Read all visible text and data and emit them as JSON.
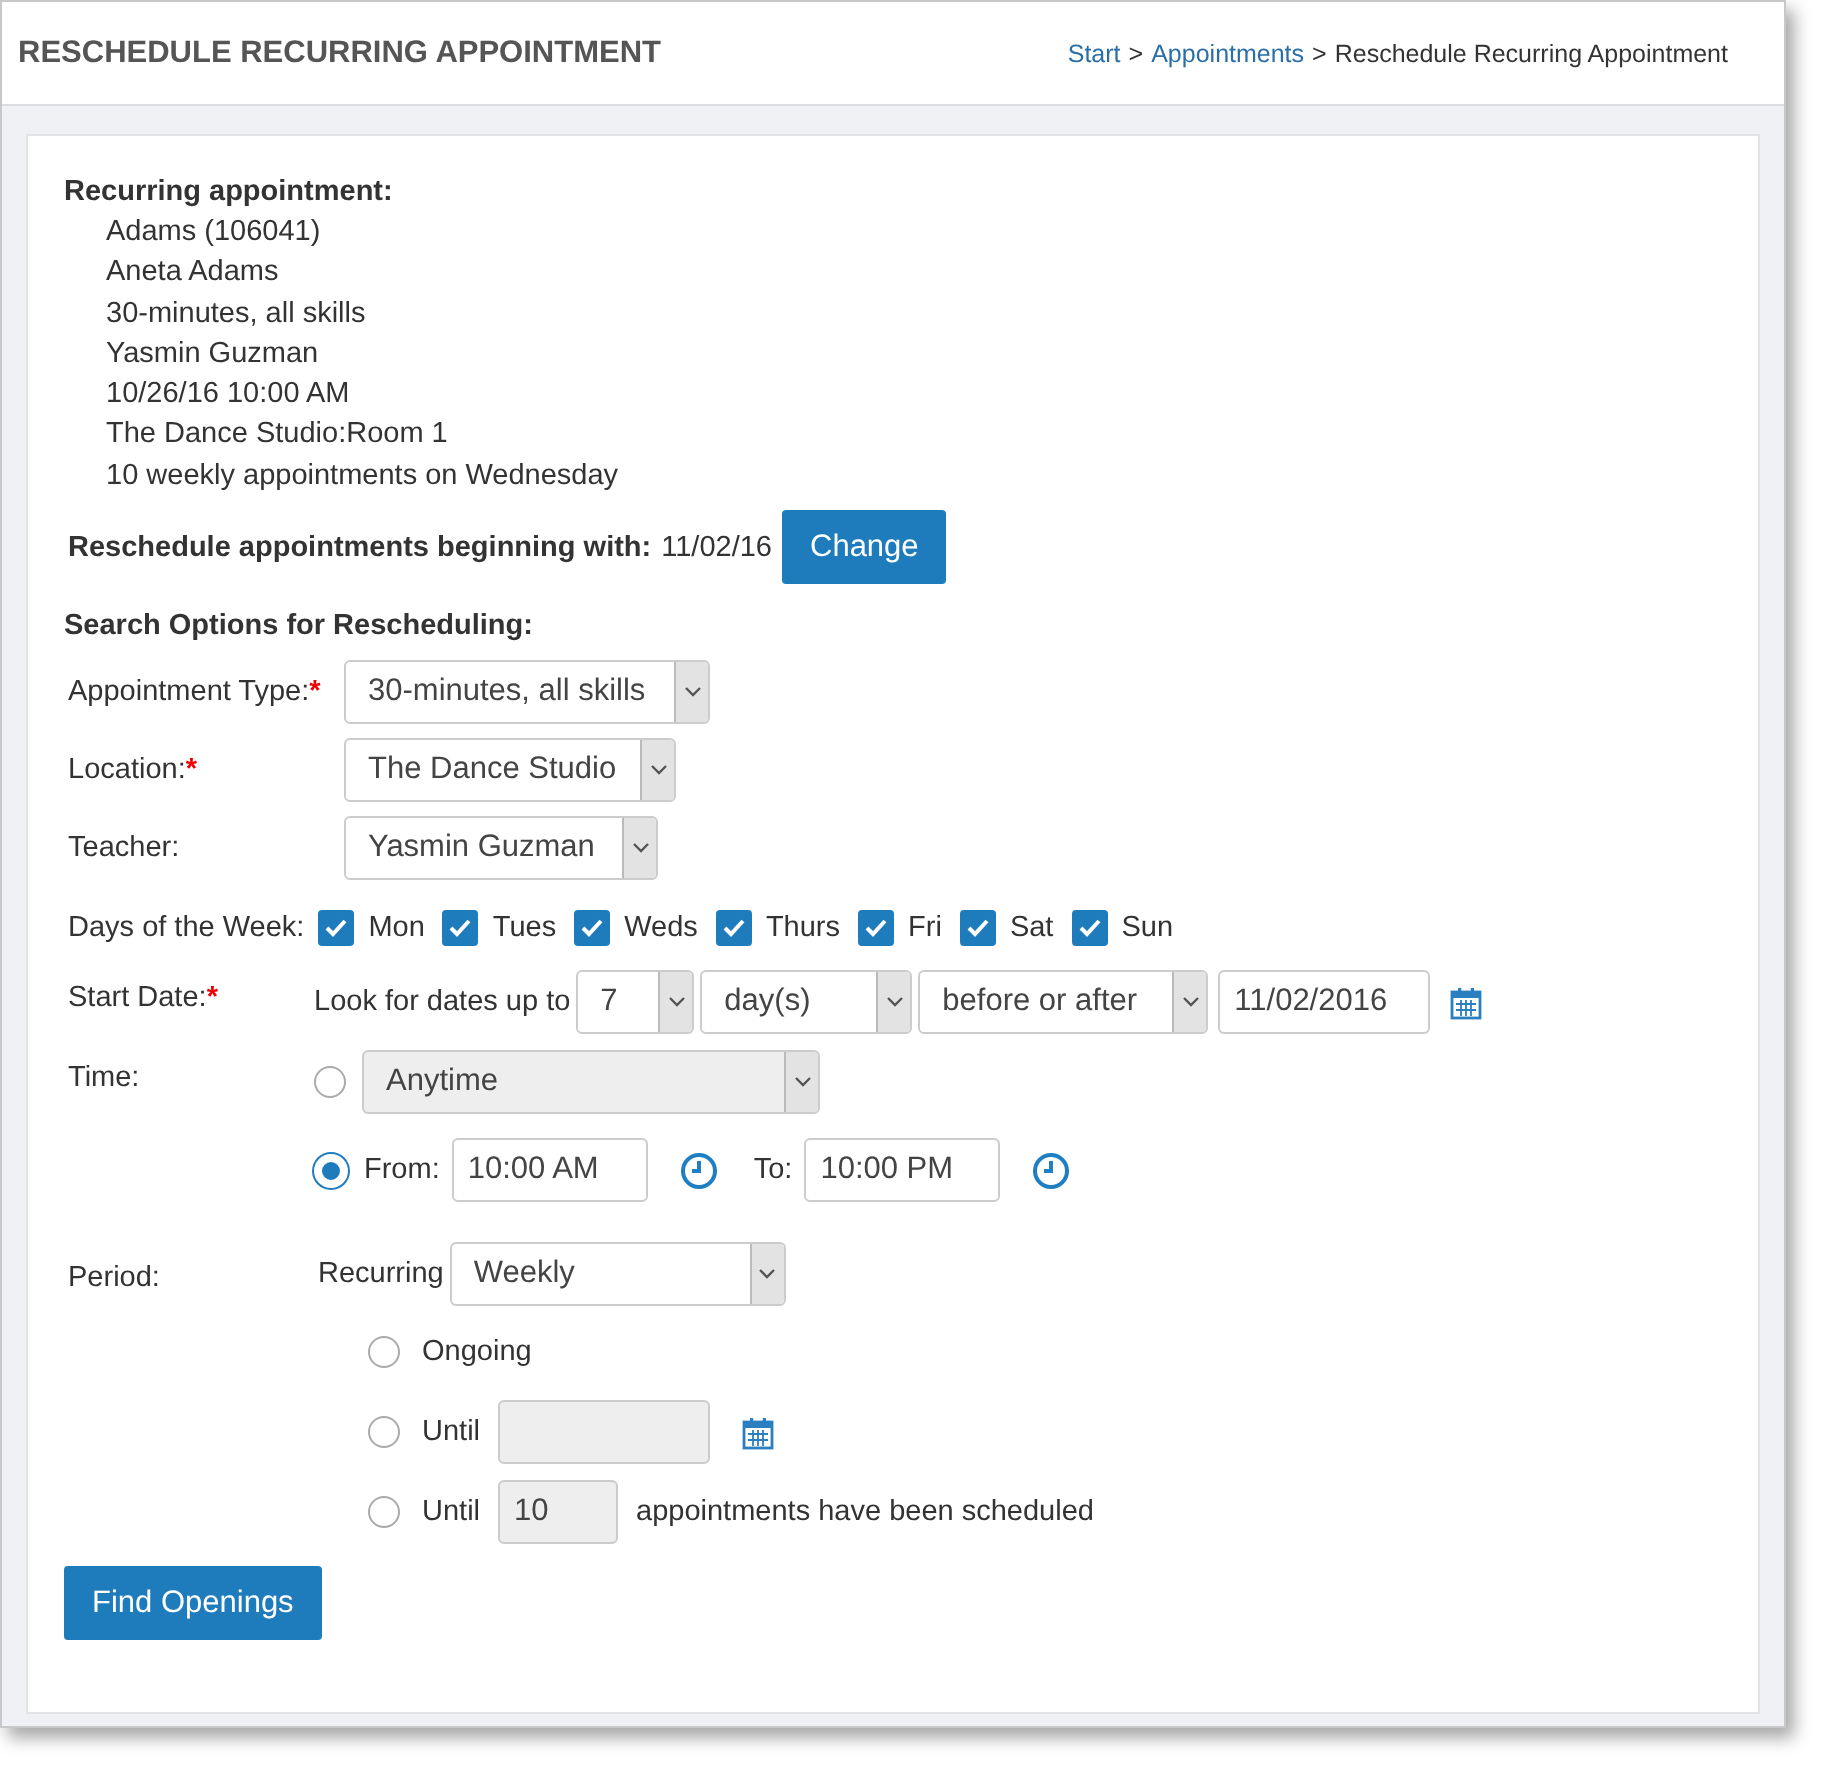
{
  "header": {
    "title": "RESCHEDULE RECURRING APPOINTMENT",
    "breadcrumb": [
      {
        "text": "Start",
        "kind": "link"
      },
      {
        "text": ">",
        "kind": "separator"
      },
      {
        "text": "Appointments",
        "kind": "link"
      },
      {
        "text": ">",
        "kind": "separator"
      },
      {
        "text": "Reschedule Recurring Appointment",
        "kind": "current"
      }
    ]
  },
  "summary": {
    "heading": "Recurring appointment:",
    "lines": [
      "Adams (106041)",
      "Aneta Adams",
      "30-minutes, all skills",
      "Yasmin Guzman",
      "10/26/16 10:00 AM",
      "The Dance Studio:Room 1",
      "10 weekly appointments on Wednesday"
    ]
  },
  "reschedule": {
    "label": "Reschedule appointments beginning with:",
    "value": "11/02/16",
    "button": "Change"
  },
  "search_options": {
    "heading": "Search Options for Rescheduling:",
    "selects": [
      {
        "label": "Appointment Type:",
        "required_mark": "*",
        "value": "30-minutes, all skills"
      },
      {
        "label": "Location:",
        "required_mark": "*",
        "value": "The Dance Studio"
      },
      {
        "label": "Teacher:",
        "value": "Yasmin Guzman"
      }
    ],
    "days": {
      "label": "Days of the Week:",
      "items": [
        {
          "label": "Mon",
          "checked": true
        },
        {
          "label": "Tues",
          "checked": true
        },
        {
          "label": "Weds",
          "checked": true
        },
        {
          "label": "Thurs",
          "checked": true
        },
        {
          "label": "Fri",
          "checked": true
        },
        {
          "label": "Sat",
          "checked": true
        },
        {
          "label": "Sun",
          "checked": true
        }
      ]
    },
    "start_date": {
      "label": "Start Date:",
      "required_mark": "*",
      "prefix": "Look for dates up to",
      "amount": "7",
      "unit": "day(s)",
      "direction": "before or after",
      "date": "11/02/2016"
    },
    "time": {
      "label": "Time:",
      "options": [
        {
          "kind": "preset",
          "selected": false,
          "value": "Anytime",
          "disabled": true
        },
        {
          "kind": "range",
          "selected": true,
          "from_label": "From:",
          "from": "10:00 AM",
          "to_label": "To:",
          "to": "10:00 PM"
        }
      ]
    },
    "period": {
      "label": "Period:",
      "recurring_label": "Recurring",
      "recurring": "Weekly",
      "options": [
        {
          "kind": "ongoing",
          "label": "Ongoing",
          "selected": false
        },
        {
          "kind": "until_date",
          "label": "Until",
          "selected": false,
          "disabled": true
        },
        {
          "kind": "until_count",
          "label": "Until",
          "value": "10",
          "suffix": "appointments have been scheduled",
          "selected": false,
          "disabled": true
        }
      ]
    }
  },
  "find_button": "Find Openings"
}
